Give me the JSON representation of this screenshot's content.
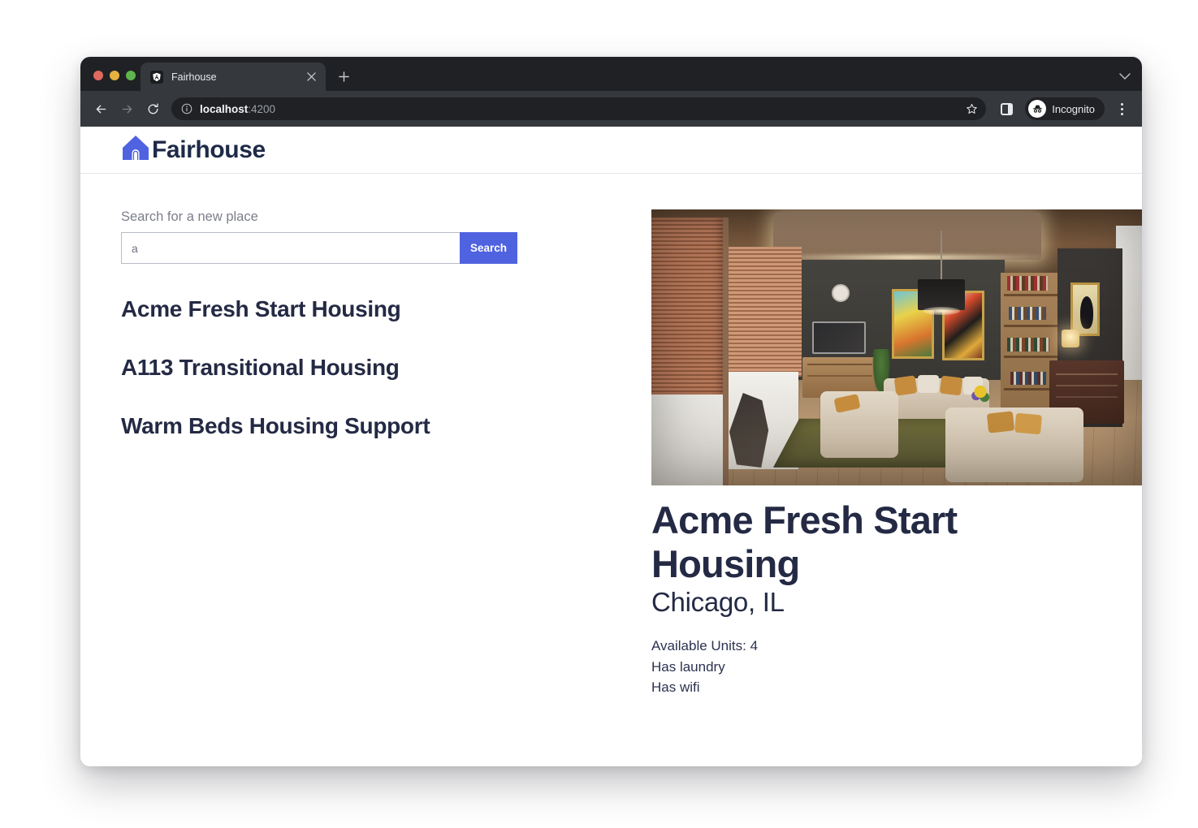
{
  "browser": {
    "tab": {
      "title": "Fairhouse",
      "favicon_icon": "angular-shield-icon",
      "close_icon": "close-icon"
    },
    "new_tab_icon": "plus-icon",
    "tabstrip_chevron_icon": "chevron-down-icon",
    "nav": {
      "back_icon": "back-arrow-icon",
      "forward_icon": "forward-arrow-icon",
      "reload_icon": "reload-icon"
    },
    "omnibox": {
      "info_icon": "info-circle-icon",
      "host": "localhost",
      "port": ":4200",
      "star_icon": "bookmark-star-icon"
    },
    "side_panel_icon": "side-panel-icon",
    "profile": {
      "label": "Incognito",
      "avatar_icon": "incognito-hat-icon"
    },
    "menu_icon": "three-dot-menu-icon",
    "traffic_lights": [
      "close-red",
      "minimize-yellow",
      "zoom-green"
    ]
  },
  "site": {
    "brand": {
      "name": "Fairhouse",
      "logo_icon": "house-icon"
    }
  },
  "search": {
    "label": "Search for a new place",
    "value": "a",
    "placeholder": "",
    "button_label": "Search"
  },
  "housing_list": [
    {
      "name": "Acme Fresh Start Housing"
    },
    {
      "name": "A113 Transitional Housing"
    },
    {
      "name": "Warm Beds Housing Support"
    }
  ],
  "detail": {
    "photo_alt": "living-room-photo",
    "title": "Acme Fresh Start Housing",
    "city": "Chicago, IL",
    "facts": [
      "Available Units: 4",
      "Has laundry",
      "Has wifi"
    ]
  },
  "colors": {
    "accent": "#4f62e0",
    "text_dark": "#242a44",
    "label_gray": "#7c7f8a",
    "chrome_dark": "#202124",
    "chrome_toolbar": "#35383c"
  }
}
